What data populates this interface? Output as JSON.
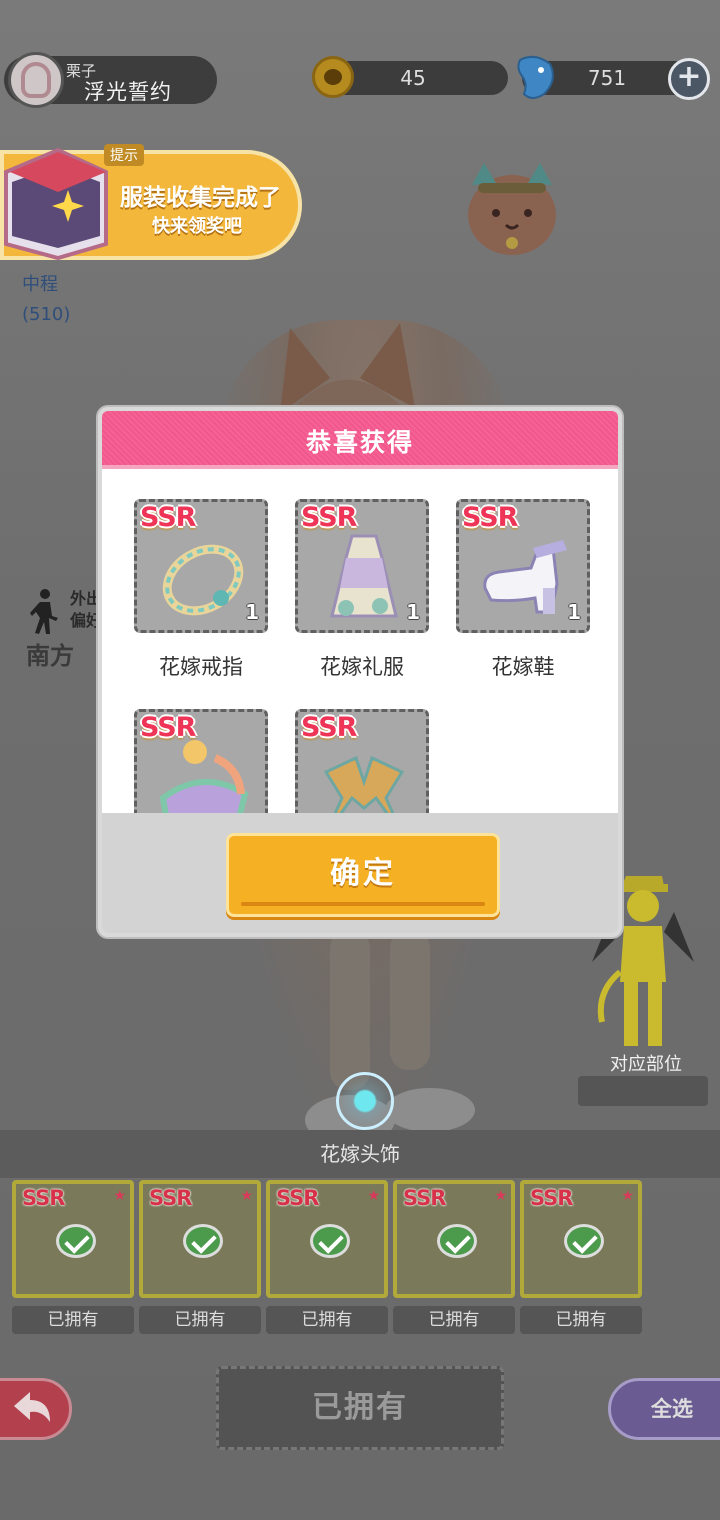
{
  "player": {
    "name": "栗子",
    "title": "浮光誓约"
  },
  "currency": {
    "gold": "45",
    "gems": "751",
    "gold_icon": "paw-coin-icon",
    "gem_icon": "blue-fish-gem-icon"
  },
  "tip": {
    "tag": "提示",
    "line1": "服装收集完成了",
    "line2": "快来领奖吧"
  },
  "distance": {
    "label": "中程",
    "value": "(510)"
  },
  "outing": {
    "label_line1": "外出",
    "label_line2": "偏好",
    "direction": "南方"
  },
  "part": {
    "label": "对应部位"
  },
  "current_item": {
    "name": "花嫁头饰"
  },
  "collection": [
    {
      "rarity": "SSR",
      "status": "已拥有",
      "icon": "ring-icon"
    },
    {
      "rarity": "SSR",
      "status": "已拥有",
      "icon": "skirt-icon"
    },
    {
      "rarity": "SSR",
      "status": "已拥有",
      "icon": "ribbon-icon"
    },
    {
      "rarity": "SSR",
      "status": "已拥有",
      "icon": "shoes-icon"
    },
    {
      "rarity": "SSR",
      "status": "已拥有",
      "icon": "dress-icon"
    }
  ],
  "actions": {
    "owned": "已拥有",
    "select_all": "全选"
  },
  "modal": {
    "title": "恭喜获得",
    "confirm": "确定",
    "rewards": [
      {
        "rarity": "SSR",
        "name": "花嫁戒指",
        "count": "1",
        "icon": "ring-icon"
      },
      {
        "rarity": "SSR",
        "name": "花嫁礼服",
        "count": "1",
        "icon": "dress-icon"
      },
      {
        "rarity": "SSR",
        "name": "花嫁鞋",
        "count": "1",
        "icon": "shoes-icon"
      },
      {
        "rarity": "SSR",
        "name": "",
        "count": "",
        "icon": "skirt-icon"
      },
      {
        "rarity": "SSR",
        "name": "",
        "count": "",
        "icon": "ribbon-icon"
      }
    ]
  },
  "colors": {
    "modal_header": "#f2578c",
    "confirm_button": "#f5b024",
    "rarity_text": "#ef3557",
    "tip_banner": "#f3b73c"
  }
}
